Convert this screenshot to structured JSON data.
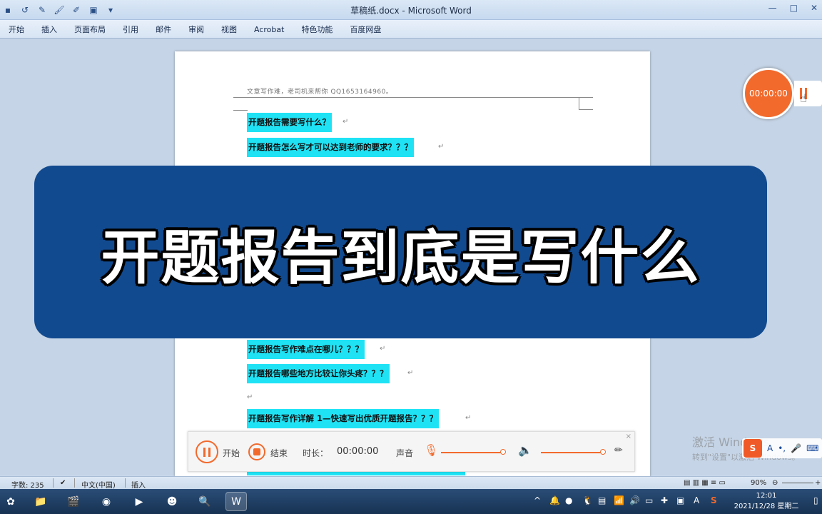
{
  "window": {
    "title": "草稿纸.docx - Microsoft Word",
    "qat_icons": [
      "word-logo-icon",
      "undo-icon",
      "format-painter-icon",
      "brush-icon",
      "pen-icon",
      "save-icon",
      "qat-dropdown-icon"
    ],
    "controls": [
      "—",
      "□",
      "✕"
    ]
  },
  "ribbon": {
    "tabs": [
      "开始",
      "插入",
      "页面布局",
      "引用",
      "邮件",
      "审阅",
      "视图",
      "Acrobat",
      "特色功能",
      "百度网盘"
    ]
  },
  "document": {
    "header": "文章写作难，老司机来帮你    QQ1653164960。",
    "paragraphs": [
      "开题报告需要写什么？",
      "开题报告怎么写才可以达到老师的要求？？？",
      "开题报告写作难点在哪儿？？？",
      "开题报告哪些地方比较让你头疼？？？",
      "开题报告写作详解 1—快速写出优质开题报告？？？"
    ],
    "paragraph_mark": "↵"
  },
  "banner": {
    "text": "开题报告到底是写什么"
  },
  "recorder": {
    "timer": "00:00:00",
    "pause_label": "开始",
    "stop_label": "结束",
    "duration_label": "时长：",
    "duration_value": "00:00:00",
    "sound_label": "声音",
    "close": "×"
  },
  "statusbar": {
    "word_count": "字数: 235",
    "language": "中文(中国)",
    "mode": "插入",
    "zoom": "90%",
    "zoom_minus": "⊖",
    "zoom_plus": "+"
  },
  "taskbar": {
    "clock_time": "12:01",
    "clock_date": "2021/12/28 星期二"
  },
  "watermark": {
    "line1": "激活 Windows",
    "line2": "转到\"设置\"以激活 Windows。"
  },
  "ime": {
    "logo": "S",
    "items": [
      "A",
      "•,",
      "🎤",
      "⌨"
    ]
  }
}
